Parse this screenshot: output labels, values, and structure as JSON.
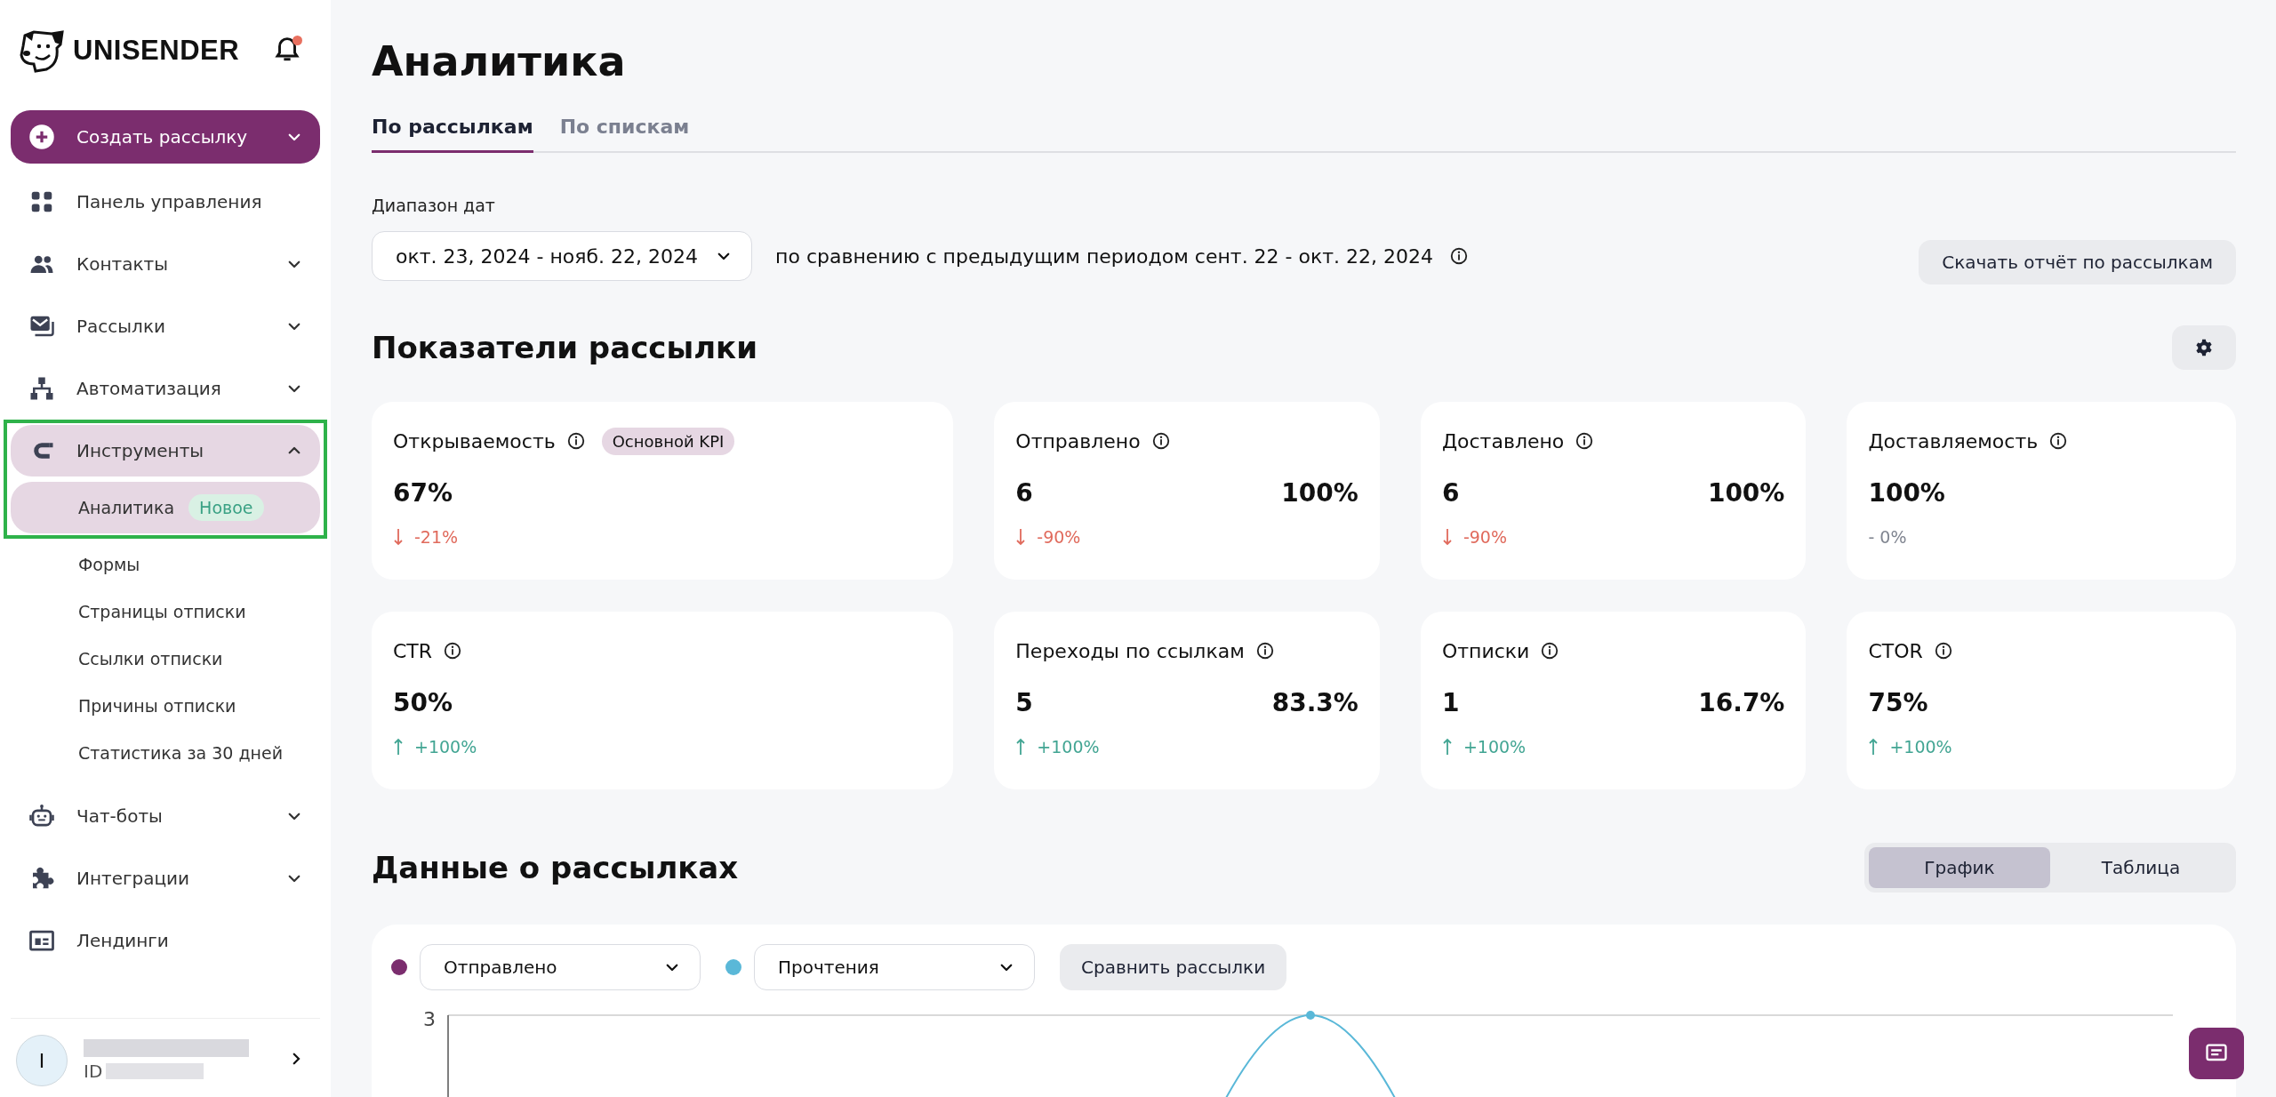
{
  "sidebar": {
    "logo_text": "UNISENDER",
    "has_notification": true,
    "create_button": {
      "label": "Создать рассылку"
    },
    "items": [
      {
        "label": "Панель управления",
        "selected": false
      },
      {
        "label": "Контакты",
        "expanded": false,
        "selected": false
      },
      {
        "label": "Рассылки",
        "expanded": false,
        "selected": false
      },
      {
        "label": "Автоматизация",
        "expanded": false,
        "selected": false
      },
      {
        "label": "Инструменты",
        "expanded": true,
        "selected": true,
        "highlighted": true,
        "children": [
          {
            "label": "Аналитика",
            "badge": "Новое",
            "selected": true
          },
          {
            "label": "Формы",
            "selected": false
          },
          {
            "label": "Страницы отписки",
            "selected": false
          },
          {
            "label": "Ссылки отписки",
            "selected": false
          },
          {
            "label": "Причины отписки",
            "selected": false
          },
          {
            "label": "Статистика за 30 дней",
            "selected": false
          }
        ]
      },
      {
        "label": "Чат-боты",
        "expanded": false,
        "selected": false
      },
      {
        "label": "Интеграции",
        "expanded": false,
        "selected": false
      },
      {
        "label": "Лендинги",
        "selected": false
      }
    ],
    "user": {
      "avatar_letter": "I",
      "id_label": "ID"
    }
  },
  "page": {
    "title": "Аналитика",
    "tabs": [
      {
        "label": "По рассылкам",
        "selected": true
      },
      {
        "label": "По спискам",
        "selected": false
      }
    ],
    "date_range": {
      "label": "Диапазон дат",
      "value": "окт. 23, 2024 - нояб. 22, 2024"
    },
    "comparison_text": "по сравнению с предыдущим периодом сент. 22 - окт. 22, 2024",
    "download_button": "Скачать отчёт по рассылкам",
    "metrics_title": "Показатели рассылки",
    "metrics": [
      {
        "title": "Открываемость",
        "badge": "Основной KPI",
        "value": "67%",
        "delta": "-21%",
        "kind": "down"
      },
      {
        "title": "Отправлено",
        "value": "6",
        "percent": "100%",
        "delta": "-90%",
        "kind": "down"
      },
      {
        "title": "Доставлено",
        "value": "6",
        "percent": "100%",
        "delta": "-90%",
        "kind": "down"
      },
      {
        "title": "Доставляемость",
        "value": "100%",
        "delta": "- 0%",
        "kind": "flat"
      },
      {
        "title": "CTR",
        "value": "50%",
        "delta": "+100%",
        "kind": "up"
      },
      {
        "title": "Переходы по ссылкам",
        "value": "5",
        "percent": "83.3%",
        "delta": "+100%",
        "kind": "up"
      },
      {
        "title": "Отписки",
        "value": "1",
        "percent": "16.7%",
        "delta": "+100%",
        "kind": "up"
      },
      {
        "title": "CTOR",
        "value": "75%",
        "delta": "+100%",
        "kind": "up"
      }
    ],
    "data_title": "Данные о рассылках",
    "view_toggle": [
      {
        "label": "График",
        "selected": true
      },
      {
        "label": "Таблица",
        "selected": false
      }
    ],
    "series_selects": [
      {
        "value": "Отправлено",
        "color": "#7b2d6e"
      },
      {
        "value": "Прочтения",
        "color": "#5ab8d8"
      }
    ],
    "compare_button": "Сравнить рассылки",
    "chart_tick": "3"
  }
}
